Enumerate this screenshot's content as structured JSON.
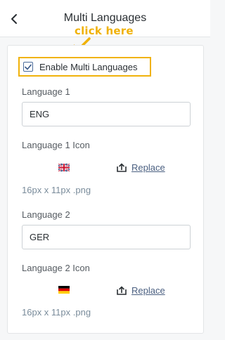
{
  "header": {
    "title": "Multi Languages",
    "back_icon": "chevron-left-icon"
  },
  "annotation": {
    "text": "click here",
    "color": "#f0b20a"
  },
  "settings": {
    "enable_label": "Enable Multi Languages",
    "enable_checked": true,
    "languages": [
      {
        "label": "Language 1",
        "value": "ENG",
        "icon_label": "Language 1 Icon",
        "flag_icon": "uk-flag-icon",
        "replace_label": "Replace",
        "replace_icon": "upload-icon",
        "hint": "16px x 11px .png"
      },
      {
        "label": "Language 2",
        "value": "GER",
        "icon_label": "Language 2 Icon",
        "flag_icon": "germany-flag-icon",
        "replace_label": "Replace",
        "replace_icon": "upload-icon",
        "hint": "16px x 11px .png"
      }
    ]
  }
}
